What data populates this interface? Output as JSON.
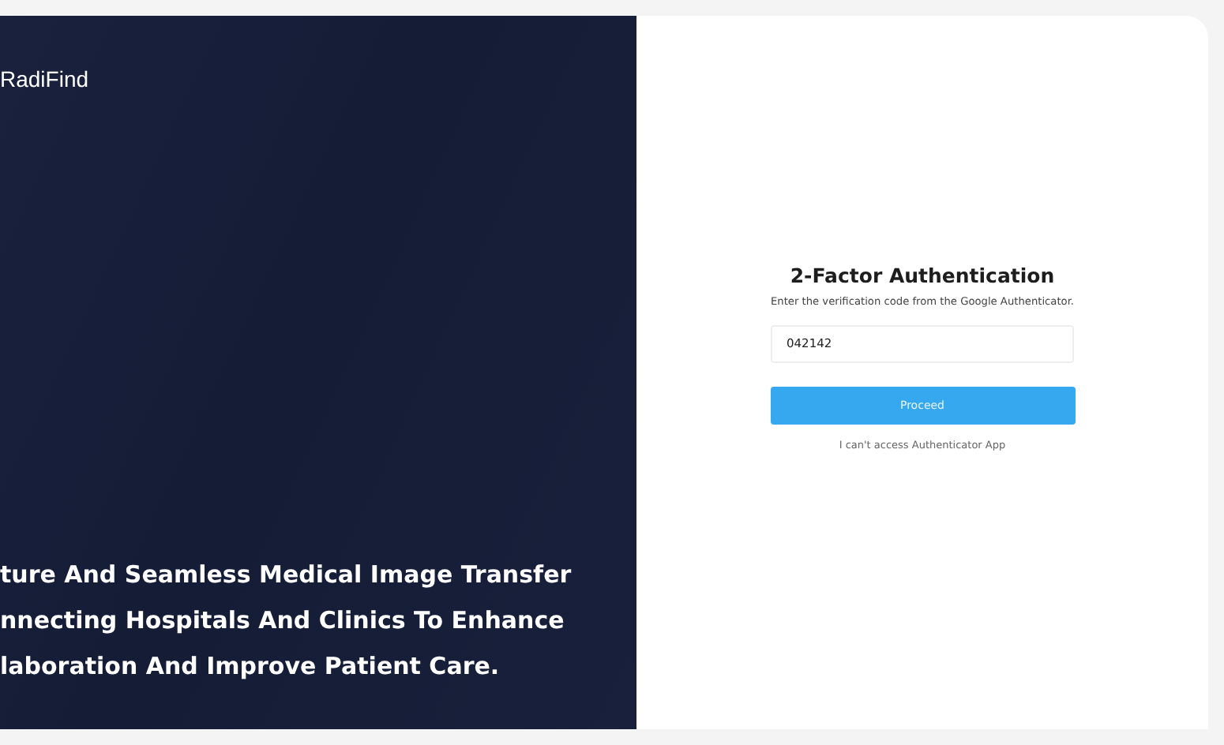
{
  "brand": {
    "name": "RadiFind"
  },
  "tagline_lines": [
    "ture And Seamless Medical Image Transfer",
    "nnecting Hospitals And Clinics To Enhance",
    "laboration And Improve Patient Care."
  ],
  "form": {
    "title": "2-Factor Authentication",
    "subtitle": "Enter the verification code from the Google Authenticator.",
    "code": {
      "value": "042142"
    },
    "submit": "Proceed",
    "help_link": "I can't access Authenticator App"
  }
}
